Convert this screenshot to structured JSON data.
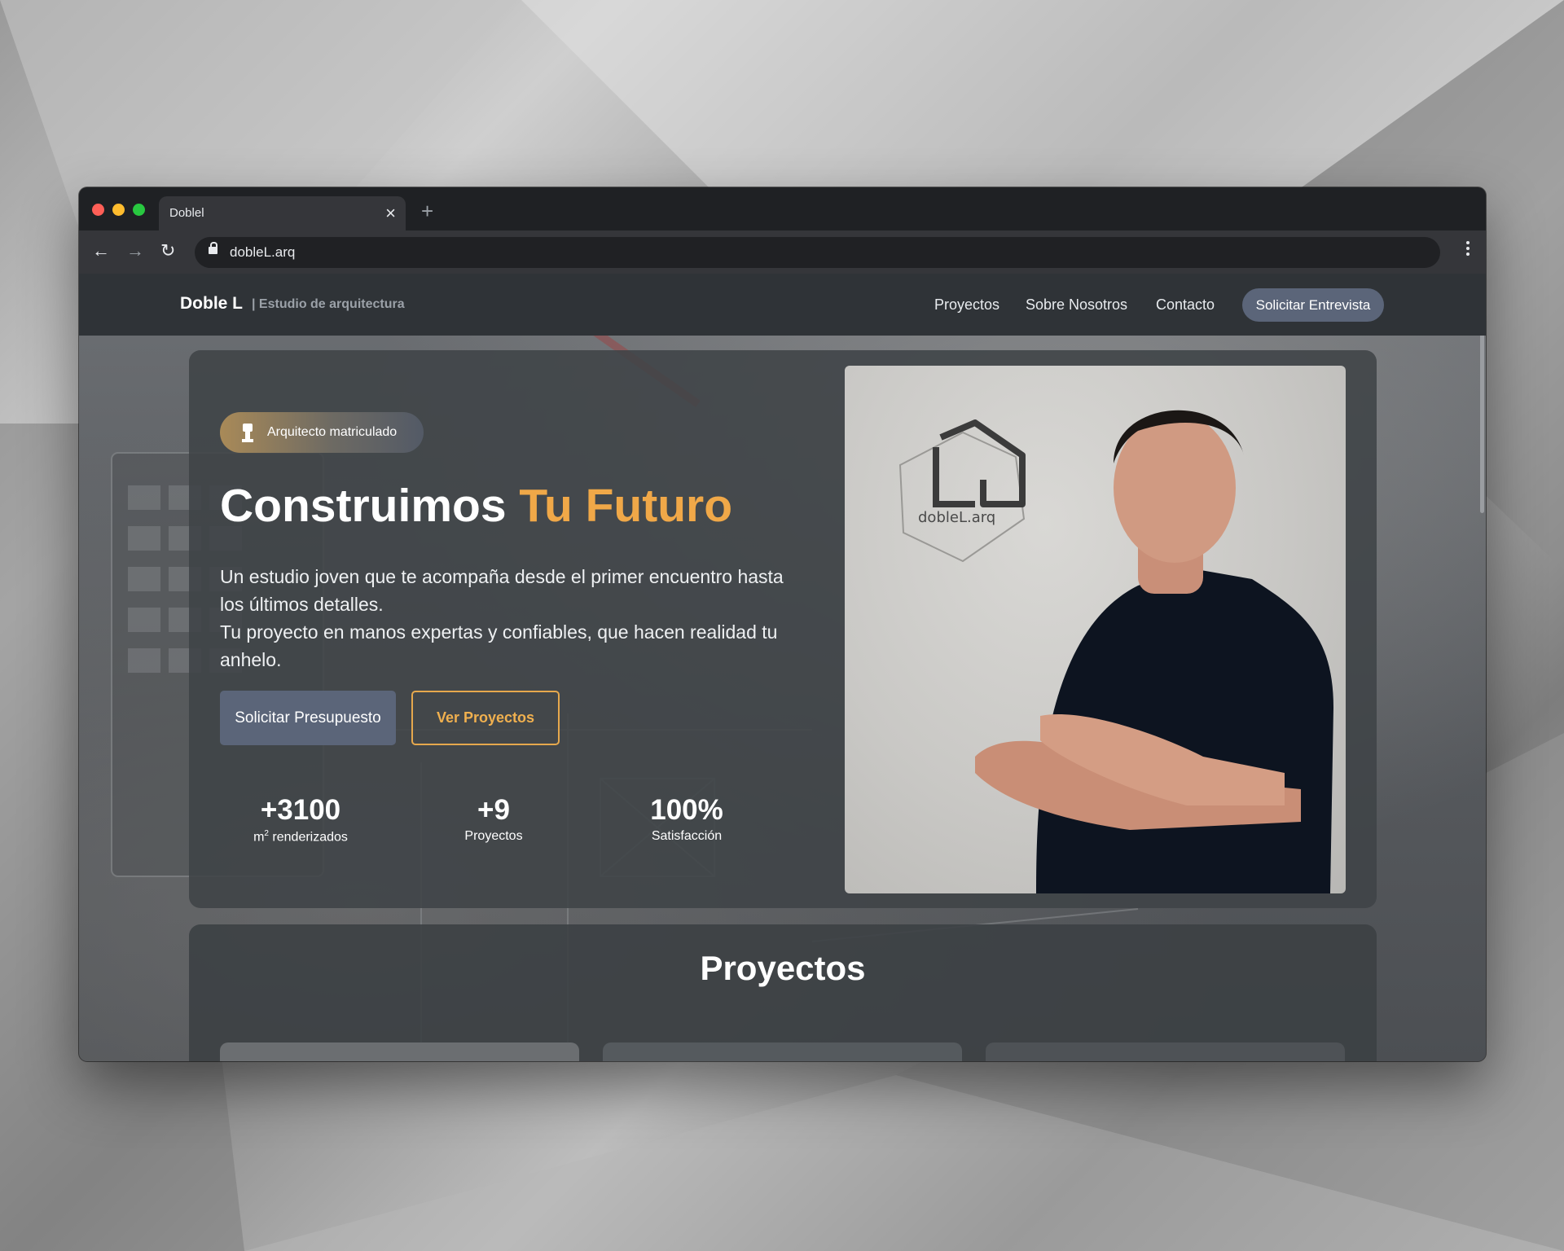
{
  "browser": {
    "tab_title": "Doblel",
    "close_glyph": "×",
    "new_tab_glyph": "+",
    "url": "dobleL.arq",
    "back_glyph": "←",
    "forward_glyph": "→",
    "reload_glyph": "↻"
  },
  "site": {
    "brand": "Doble L",
    "brand_sub": "| Estudio de arquitectura",
    "nav": [
      "Proyectos",
      "Sobre Nosotros",
      "Contacto"
    ],
    "nav_cta": "Solicitar Entrevista"
  },
  "hero": {
    "badge": "Arquitecto matriculado",
    "title_main": "Construimos ",
    "title_accent": "Tu Futuro",
    "lead_1": "Un estudio joven que te acompaña desde el primer encuentro hasta los últimos detalles.",
    "lead_2": "Tu proyecto en manos expertas y confiables, que hacen realidad tu anhelo.",
    "btn_primary": "Solicitar Presupuesto",
    "btn_outline": "Ver Proyectos",
    "stats": [
      {
        "num": "+3100",
        "lbl_prefix": "m",
        "lbl_sup": "2",
        "lbl": " renderizados"
      },
      {
        "num": "+9",
        "lbl": "Proyectos"
      },
      {
        "num": "100%",
        "lbl": "Satisfacción"
      }
    ],
    "logo_text": "dobleL.arq"
  },
  "projects": {
    "heading": "Proyectos"
  },
  "colors": {
    "accent": "#f0a848",
    "primary_button": "#5b6579",
    "nav_bg": "#2f3337"
  }
}
